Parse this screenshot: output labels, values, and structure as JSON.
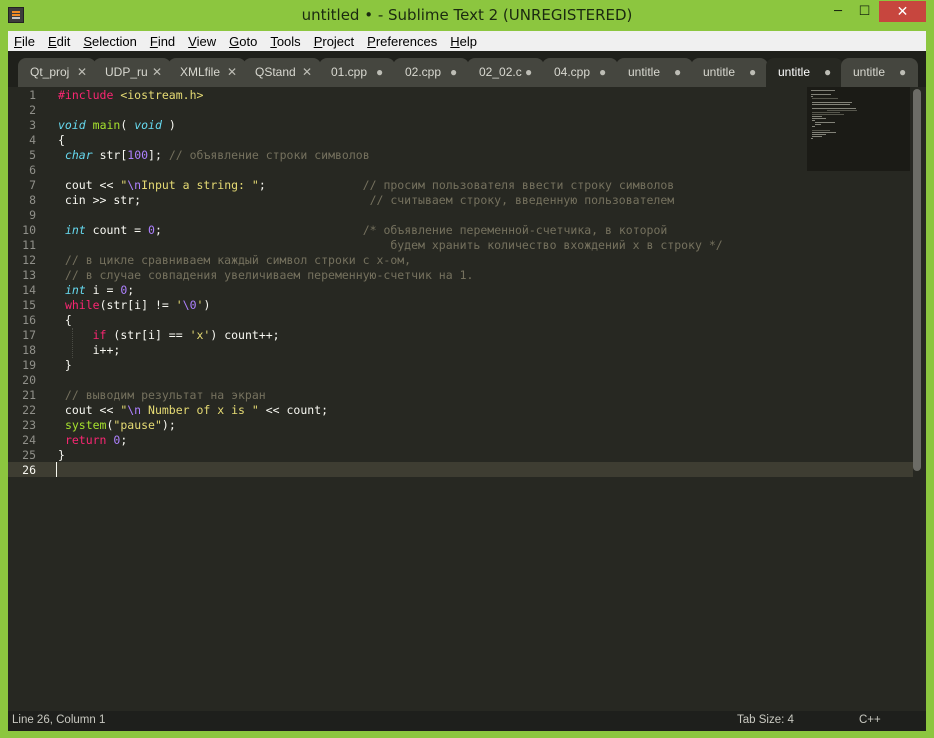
{
  "window": {
    "title": "untitled • - Sublime Text 2 (UNREGISTERED)",
    "controls": {
      "minimize": "─",
      "maximize": "☐",
      "close": "✕"
    }
  },
  "menu": [
    "File",
    "Edit",
    "Selection",
    "Find",
    "View",
    "Goto",
    "Tools",
    "Project",
    "Preferences",
    "Help"
  ],
  "tabs": [
    {
      "label": "Qt_proj",
      "control": "✕",
      "active": false
    },
    {
      "label": "UDP_ru",
      "control": "✕",
      "active": false
    },
    {
      "label": "XMLfile",
      "control": "✕",
      "active": false
    },
    {
      "label": "QStand",
      "control": "✕",
      "active": false
    },
    {
      "label": "01.cpp",
      "control": "●",
      "active": false
    },
    {
      "label": "02.cpp",
      "control": "●",
      "active": false
    },
    {
      "label": "02_02.c",
      "control": "●",
      "active": false
    },
    {
      "label": "04.cpp",
      "control": "●",
      "active": false
    },
    {
      "label": "untitle",
      "control": "●",
      "active": false
    },
    {
      "label": "untitle",
      "control": "●",
      "active": false
    },
    {
      "label": "untitle",
      "control": "●",
      "active": true
    },
    {
      "label": "untitle",
      "control": "●",
      "active": false
    }
  ],
  "editor": {
    "current_line": 26,
    "lines": [
      [
        [
          "kw",
          "#include"
        ],
        [
          "pl",
          " "
        ],
        [
          "st",
          "<iostream.h>"
        ]
      ],
      [],
      [
        [
          "ty",
          "void"
        ],
        [
          "pl",
          " "
        ],
        [
          "fn",
          "main"
        ],
        [
          "pl",
          "( "
        ],
        [
          "ty",
          "void"
        ],
        [
          "pl",
          " )"
        ]
      ],
      [
        [
          "pl",
          "{"
        ]
      ],
      [
        [
          "pl",
          " "
        ],
        [
          "ty",
          "char"
        ],
        [
          "pl",
          " str["
        ],
        [
          "nu",
          "100"
        ],
        [
          "pl",
          "]; "
        ],
        [
          "cm",
          "// объявление строки символов"
        ]
      ],
      [],
      [
        [
          "pl",
          " cout << "
        ],
        [
          "st",
          "\""
        ],
        [
          "es",
          "\\n"
        ],
        [
          "st",
          "Input a string: \""
        ],
        [
          "pl",
          ";              "
        ],
        [
          "cm",
          "// просим пользователя ввести строку символов"
        ]
      ],
      [
        [
          "pl",
          " cin >> str;                                 "
        ],
        [
          "cm",
          "// считываем строку, введенную пользователем"
        ]
      ],
      [],
      [
        [
          "pl",
          " "
        ],
        [
          "ty",
          "int"
        ],
        [
          "pl",
          " count = "
        ],
        [
          "nu",
          "0"
        ],
        [
          "pl",
          ";                             "
        ],
        [
          "cm",
          "/* объявление переменной-счетчика, в которой"
        ]
      ],
      [
        [
          "cm",
          "                                                будем хранить количество вхождений x в строку */"
        ]
      ],
      [
        [
          "cm",
          " // в цикле сравниваем каждый символ строки с x-ом,"
        ]
      ],
      [
        [
          "cm",
          " // в случае совпадения увеличиваем переменную-счетчик на 1."
        ]
      ],
      [
        [
          "pl",
          " "
        ],
        [
          "ty",
          "int"
        ],
        [
          "pl",
          " i = "
        ],
        [
          "nu",
          "0"
        ],
        [
          "pl",
          ";"
        ]
      ],
      [
        [
          "pl",
          " "
        ],
        [
          "kw",
          "while"
        ],
        [
          "pl",
          "(str[i] != "
        ],
        [
          "st",
          "'"
        ],
        [
          "es",
          "\\0"
        ],
        [
          "st",
          "'"
        ],
        [
          "pl",
          ")"
        ]
      ],
      [
        [
          "pl",
          " {"
        ]
      ],
      [
        [
          "pl",
          "     "
        ],
        [
          "kw",
          "if"
        ],
        [
          "pl",
          " (str[i] == "
        ],
        [
          "st",
          "'x'"
        ],
        [
          "pl",
          ") count++;"
        ]
      ],
      [
        [
          "pl",
          "     i++;"
        ]
      ],
      [
        [
          "pl",
          " }"
        ]
      ],
      [],
      [
        [
          "cm",
          " // выводим результат на экран"
        ]
      ],
      [
        [
          "pl",
          " cout << "
        ],
        [
          "st",
          "\""
        ],
        [
          "es",
          "\\n"
        ],
        [
          "st",
          " Number of x is \""
        ],
        [
          "pl",
          " << count;"
        ]
      ],
      [
        [
          "pl",
          " "
        ],
        [
          "fn",
          "system"
        ],
        [
          "pl",
          "("
        ],
        [
          "st",
          "\"pause\""
        ],
        [
          "pl",
          ");"
        ]
      ],
      [
        [
          "pl",
          " "
        ],
        [
          "kw",
          "return"
        ],
        [
          "pl",
          " "
        ],
        [
          "nu",
          "0"
        ],
        [
          "pl",
          ";"
        ]
      ],
      [
        [
          "pl",
          "}"
        ]
      ],
      []
    ]
  },
  "status": {
    "position": "Line 26, Column 1",
    "tab_size": "Tab Size: 4",
    "syntax": "C++"
  },
  "colors": {
    "window_frame": "#8cc63f",
    "editor_background": "#272822",
    "keyword": "#f92672",
    "type": "#66d9ef",
    "number": "#ae81ff",
    "string": "#e6db74",
    "comment": "#75715e"
  }
}
